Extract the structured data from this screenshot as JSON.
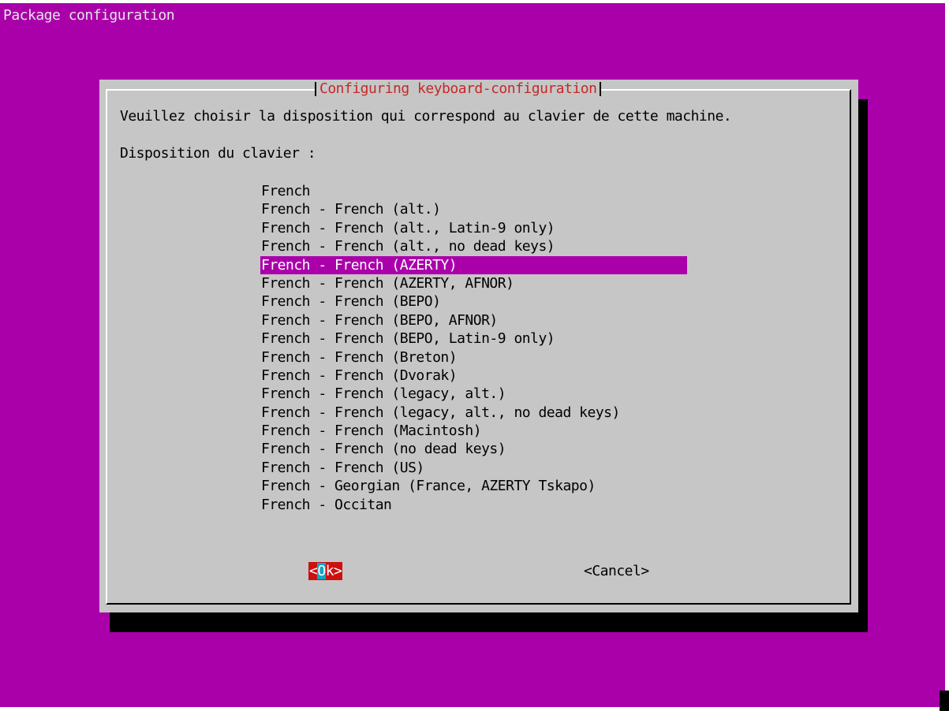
{
  "backtitle": "Package configuration",
  "dialog": {
    "title": "Configuring keyboard-configuration",
    "prompt": "Veuillez choisir la disposition qui correspond au clavier de cette machine.",
    "label": "Disposition du clavier :",
    "selected_index": 4,
    "items": [
      "French",
      "French - French (alt.)",
      "French - French (alt., Latin-9 only)",
      "French - French (alt., no dead keys)",
      "French - French (AZERTY)",
      "French - French (AZERTY, AFNOR)",
      "French - French (BEPO)",
      "French - French (BEPO, AFNOR)",
      "French - French (BEPO, Latin-9 only)",
      "French - French (Breton)",
      "French - French (Dvorak)",
      "French - French (legacy, alt.)",
      "French - French (legacy, alt., no dead keys)",
      "French - French (Macintosh)",
      "French - French (no dead keys)",
      "French - French (US)",
      "French - Georgian (France, AZERTY Tskapo)",
      "French - Occitan"
    ],
    "buttons": {
      "ok_open": "<",
      "ok_hot": "O",
      "ok_rest": "k>",
      "cancel": "<Cancel>"
    }
  },
  "colors": {
    "background": "#aa00aa",
    "dialog": "#c6c6c6",
    "title_text": "#c62828",
    "selected_bg": "#aa00aa",
    "ok_button_bg": "#cc1010",
    "hotkey_bg": "#14a4c4"
  }
}
